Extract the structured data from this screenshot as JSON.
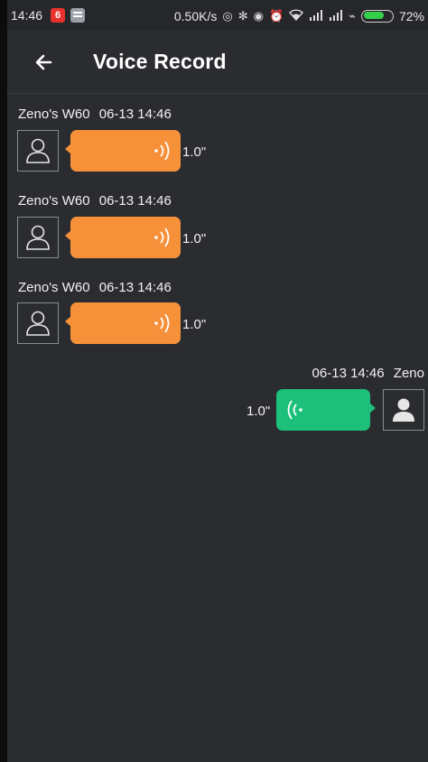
{
  "status_bar": {
    "time": "14:46",
    "speed": "0.50K/s",
    "battery": "72%",
    "battery_level": 0.72,
    "red_app_icon": "6"
  },
  "toolbar": {
    "title": "Voice Record"
  },
  "messages": [
    {
      "direction": "incoming",
      "sender": "Zeno's W60",
      "timestamp": "06-13 14:46",
      "duration": "1.0\""
    },
    {
      "direction": "incoming",
      "sender": "Zeno's W60",
      "timestamp": "06-13 14:46",
      "duration": "1.0\""
    },
    {
      "direction": "incoming",
      "sender": "Zeno's W60",
      "timestamp": "06-13 14:46",
      "duration": "1.0\""
    },
    {
      "direction": "outgoing",
      "sender": "Zeno",
      "timestamp": "06-13 14:46",
      "duration": "1.0\""
    }
  ],
  "colors": {
    "incoming_bubble": "#f6913a",
    "outgoing_bubble": "#1cc07a",
    "background": "#2b2c30"
  }
}
